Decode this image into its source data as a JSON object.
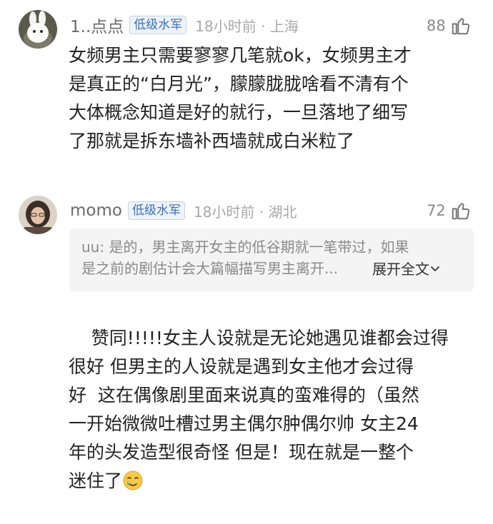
{
  "comments": [
    {
      "username": "1..点点",
      "badge": "低级水军",
      "time_location": "18小时前 · 上海",
      "likes": "88",
      "text": "女频男主只需要寥寥几笔就ok，女频男主才\n是真正的“白月光”，朦朦胧胧啥看不清有个\n大体概念知道是好的就行，一旦落地了细写\n了那就是拆东墙补西墙就成白米粒了"
    },
    {
      "username": "momo",
      "badge": "低级水军",
      "time_location": "18小时前 · 湖北",
      "likes": "72",
      "quote": {
        "text": "uu: 是的，男主离开女主的低谷期就一笔带过，如果\n是之前的剧估计会大篇幅描写男主离开...",
        "expand_label": "展开全文"
      },
      "text": "赞同!!!!!女主人设就是无论她遇见谁都会过得\n很好 但男主的人设就是遇到女主他才会过得\n好  这在偶像剧里面来说真的蛮难得的（虽然\n一开始微微吐槽过男主偶尔肿偶尔帅 女主24\n年的头发造型很奇怪 但是！现在就是一整个\n迷住了",
      "trailing_emoji": "teary-smile-emoji"
    }
  ],
  "colors": {
    "username": "#6b6b6b",
    "badge": "#3b6fb4",
    "meta": "#a8a8a8",
    "text": "#222222"
  }
}
